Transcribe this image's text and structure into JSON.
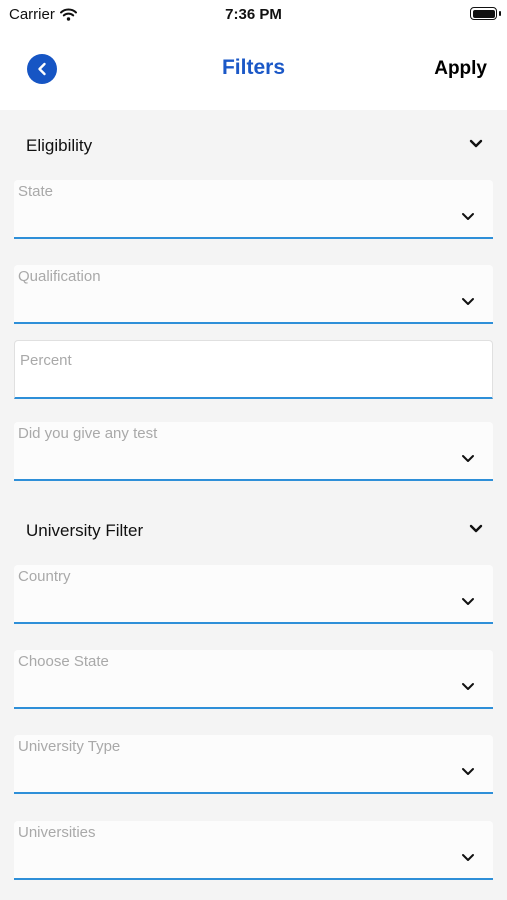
{
  "status_bar": {
    "carrier": "Carrier",
    "time": "7:36 PM"
  },
  "header": {
    "title": "Filters",
    "apply_label": "Apply"
  },
  "eligibility": {
    "title": "Eligibility",
    "state_label": "State",
    "qualification_label": "Qualification",
    "percent_placeholder": "Percent",
    "test_label": "Did you give any test"
  },
  "university_filter": {
    "title": "University Filter",
    "country_label": "Country",
    "choose_state_label": "Choose State",
    "university_type_label": "University Type",
    "universities_label": "Universities"
  },
  "colors": {
    "accent": "#1b58c7",
    "field_underline": "#2e8fd8",
    "background": "#f4f4f4"
  }
}
